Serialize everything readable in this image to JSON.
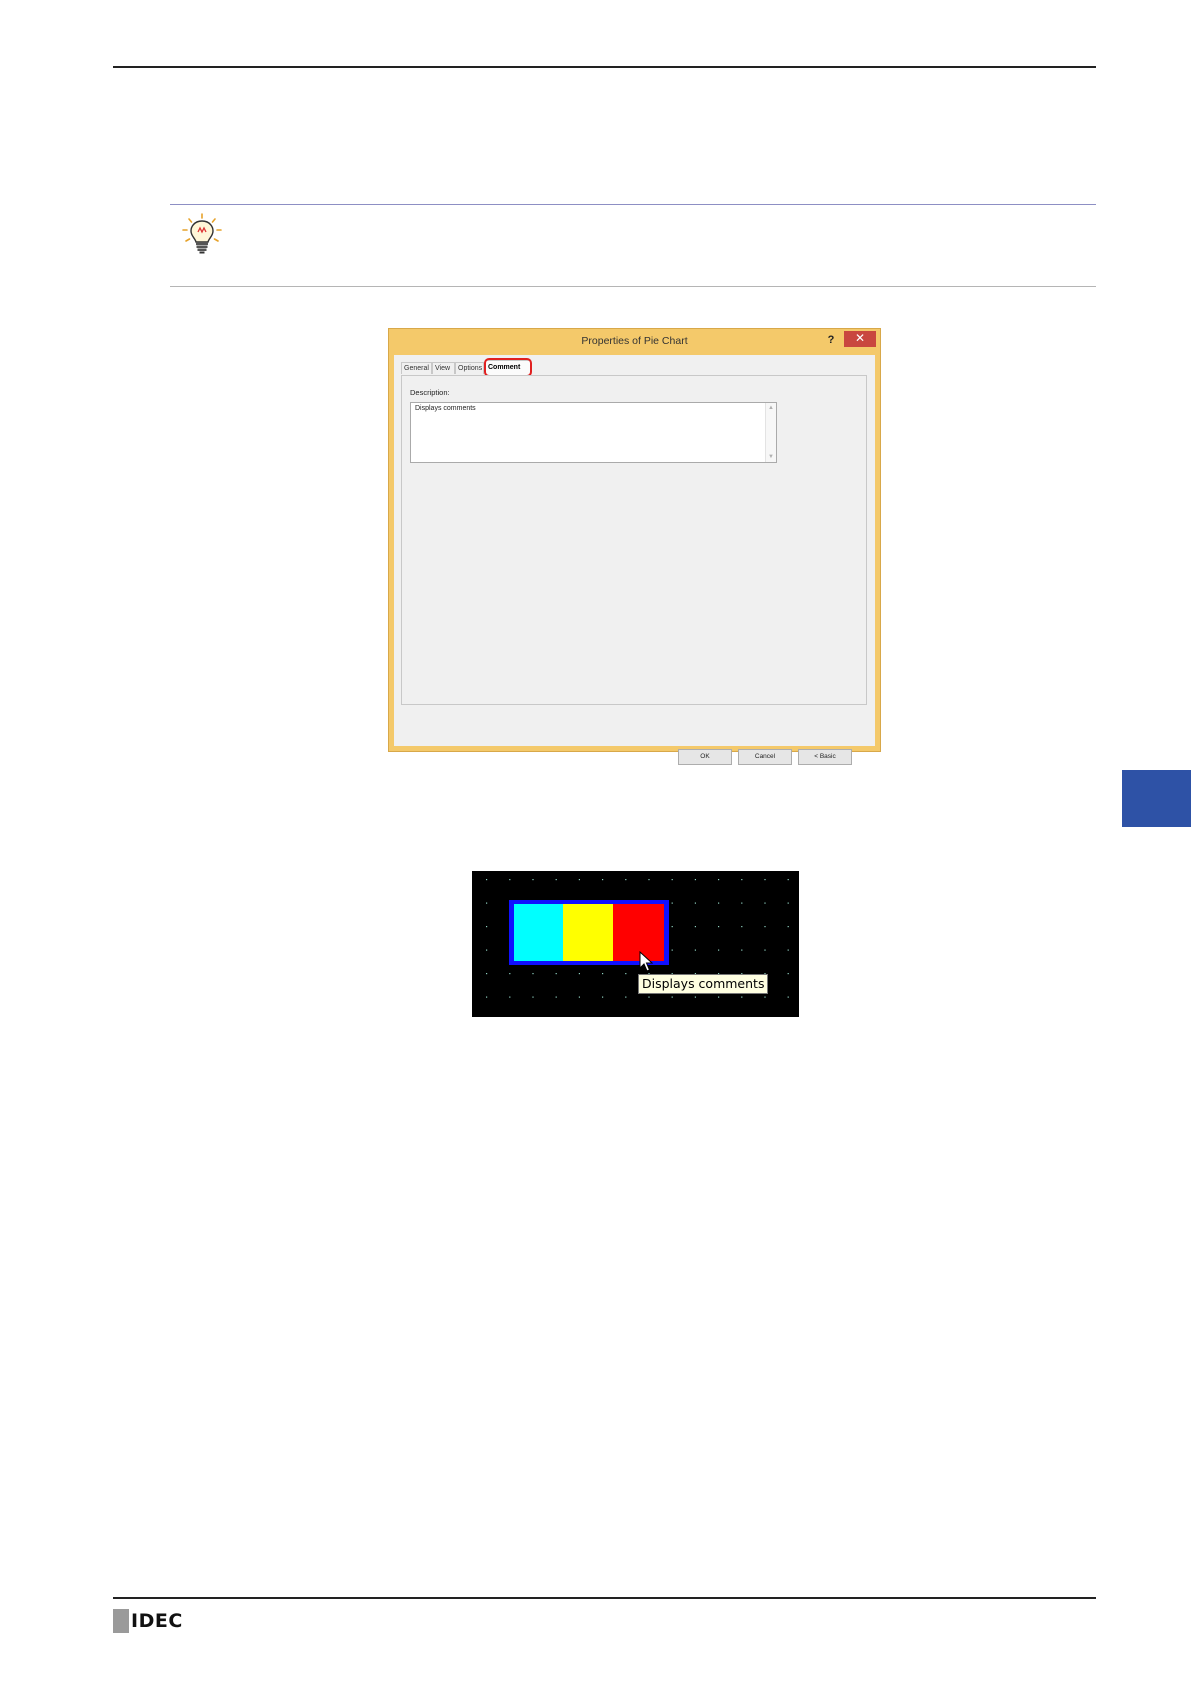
{
  "logo": {
    "text": "IDEC"
  },
  "colors": {
    "side_tab": "#2e52a6",
    "dialog_frame": "#f4c96a",
    "highlight": "#e02020"
  },
  "dialog": {
    "title": "Properties of Pie Chart",
    "help_label": "?",
    "close_label": "✕",
    "tabs": [
      "General",
      "View",
      "Options",
      "Comment"
    ],
    "active_tab": "Comment",
    "description_label": "Description:",
    "description_value": "Displays comments",
    "buttons": {
      "ok": "OK",
      "cancel": "Cancel",
      "basic": "< Basic"
    }
  },
  "preview": {
    "segment_colors": [
      "#00ffff",
      "#ffff00",
      "#ff0000"
    ],
    "frame_color": "#1010ff",
    "tooltip": "Displays comments",
    "icon": "cursor-arrow-icon"
  },
  "icons": {
    "tip": "lightbulb-icon"
  }
}
